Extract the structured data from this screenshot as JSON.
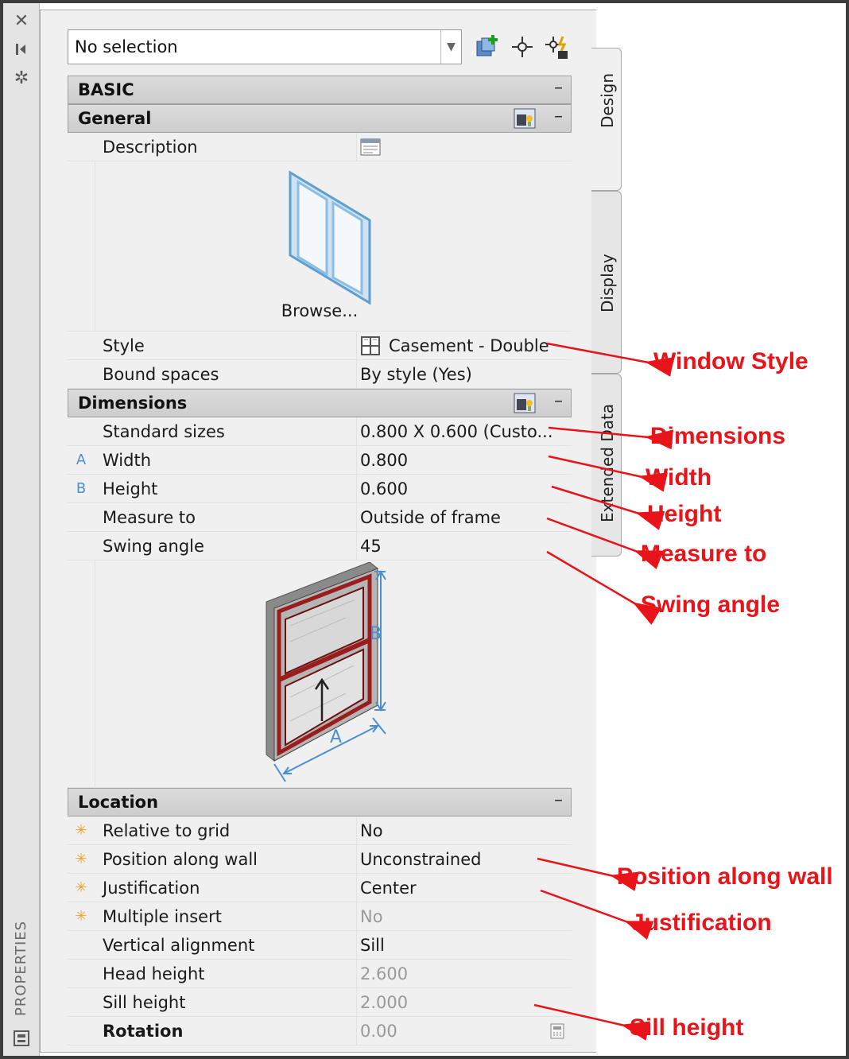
{
  "strip": {
    "label": "PROPERTIES",
    "icons": [
      "close-icon",
      "pin-icon",
      "gear-icon",
      "panel-icon"
    ]
  },
  "selection": {
    "value": "No selection"
  },
  "tabs": [
    {
      "label": "Design",
      "active": true
    },
    {
      "label": "Display",
      "active": false
    },
    {
      "label": "Extended Data",
      "active": false
    }
  ],
  "basic": {
    "title": "BASIC",
    "collapse": "–"
  },
  "general": {
    "title": "General",
    "collapse": "–",
    "description_label": "Description",
    "browse_label": "Browse...",
    "style_label": "Style",
    "style_value": "Casement - Double",
    "bound_label": "Bound spaces",
    "bound_value": "By style (Yes)"
  },
  "dimensions": {
    "title": "Dimensions",
    "collapse": "–",
    "rows": [
      {
        "marker": "",
        "label": "Standard sizes",
        "value": "0.800  X  0.600 (Custo..."
      },
      {
        "marker": "A",
        "label": "Width",
        "value": "0.800"
      },
      {
        "marker": "B",
        "label": "Height",
        "value": "0.600"
      },
      {
        "marker": "",
        "label": "Measure to",
        "value": "Outside of frame"
      },
      {
        "marker": "",
        "label": "Swing angle",
        "value": "45"
      }
    ],
    "diagram_a": "A",
    "diagram_b": "B"
  },
  "location": {
    "title": "Location",
    "collapse": "–",
    "rows": [
      {
        "marker": "star",
        "label": "Relative to grid",
        "value": "No",
        "muted": false
      },
      {
        "marker": "star",
        "label": "Position along wall",
        "value": "Unconstrained",
        "muted": false
      },
      {
        "marker": "star",
        "label": "Justification",
        "value": "Center",
        "muted": false
      },
      {
        "marker": "star",
        "label": "Multiple insert",
        "value": "No",
        "muted": true
      },
      {
        "marker": "",
        "label": "Vertical alignment",
        "value": "Sill",
        "muted": false
      },
      {
        "marker": "",
        "label": "Head height",
        "value": "2.600",
        "muted": true
      },
      {
        "marker": "",
        "label": "Sill height",
        "value": "2.000",
        "muted": false
      },
      {
        "marker": "",
        "label": "Rotation",
        "value": "0.00",
        "muted": true
      }
    ]
  },
  "annotations": {
    "window_style": "Window Style",
    "dimensions": "Dimensions",
    "width": "Width",
    "height": "Height",
    "measure_to": "Measure to",
    "swing_angle": "Swing angle",
    "position_along_wall": "Position along wall",
    "justification": "Justification",
    "sill_height": "Sill height"
  },
  "colors": {
    "annotation": "#e8141a",
    "dimension_blue": "#4a8fd4",
    "star_orange": "#f0a030"
  }
}
